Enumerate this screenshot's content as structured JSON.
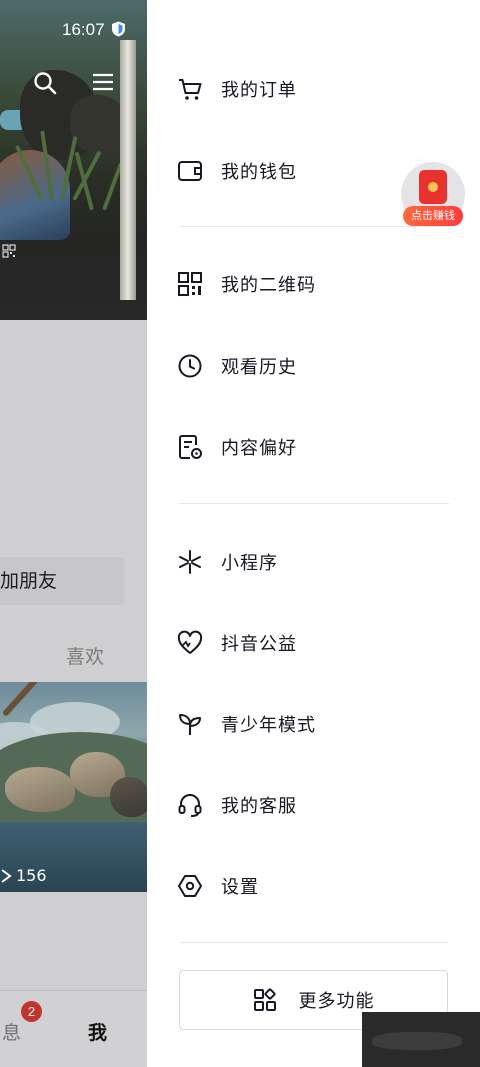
{
  "status_bar": {
    "time": "16:07"
  },
  "background_page": {
    "add_friend": "加朋友",
    "likes_tab": "喜欢",
    "play_count": "156",
    "bottom_tabs": {
      "messages": "息",
      "messages_badge": "2",
      "me": "我"
    }
  },
  "drawer": {
    "items": [
      {
        "label": "我的订单",
        "icon": "cart-icon"
      },
      {
        "label": "我的钱包",
        "icon": "wallet-icon"
      },
      {
        "label": "我的二维码",
        "icon": "qr-code-icon"
      },
      {
        "label": "观看历史",
        "icon": "clock-icon"
      },
      {
        "label": "内容偏好",
        "icon": "content-settings-icon"
      },
      {
        "label": "小程序",
        "icon": "mini-program-icon"
      },
      {
        "label": "抖音公益",
        "icon": "heart-charity-icon"
      },
      {
        "label": "青少年模式",
        "icon": "sprout-icon"
      },
      {
        "label": "我的客服",
        "icon": "headset-icon"
      },
      {
        "label": "设置",
        "icon": "hexagon-settings-icon"
      }
    ],
    "earn_widget": {
      "label": "点击赚钱"
    },
    "more_button": {
      "label": "更多功能",
      "icon": "grid-apps-icon"
    }
  }
}
